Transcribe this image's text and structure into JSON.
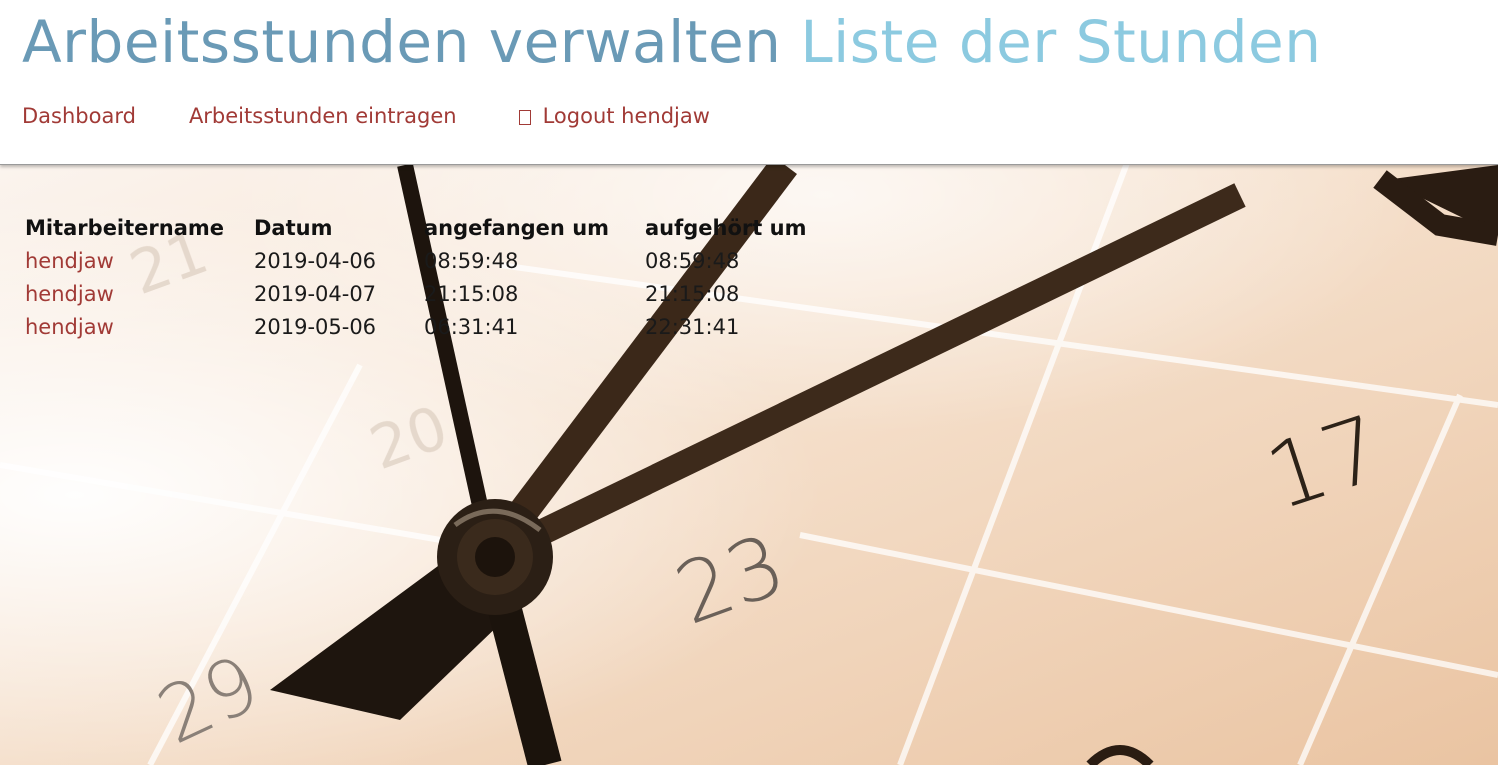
{
  "header": {
    "title_main": "Arbeitsstunden verwalten",
    "title_sub": "Liste der Stunden"
  },
  "nav": {
    "dashboard": "Dashboard",
    "eintragen": "Arbeitsstunden eintragen",
    "logout": "Logout hendjaw",
    "logout_icon": "logout-icon"
  },
  "background": {
    "numbers": [
      "17",
      "23",
      "29"
    ]
  },
  "table": {
    "columns": [
      "Mitarbeitername",
      "Datum",
      "angefangen um",
      "aufgehört um"
    ],
    "rows": [
      {
        "name": "hendjaw",
        "date": "2019-04-06",
        "start": "08:59:48",
        "end": "08:59:48"
      },
      {
        "name": "hendjaw",
        "date": "2019-04-07",
        "start": "21:15:08",
        "end": "21:15:08"
      },
      {
        "name": "hendjaw",
        "date": "2019-05-06",
        "start": "06:31:41",
        "end": "22:31:41"
      }
    ]
  },
  "colors": {
    "title_main": "#6a9ab6",
    "title_sub": "#8ccae0",
    "link": "#a13a36"
  }
}
